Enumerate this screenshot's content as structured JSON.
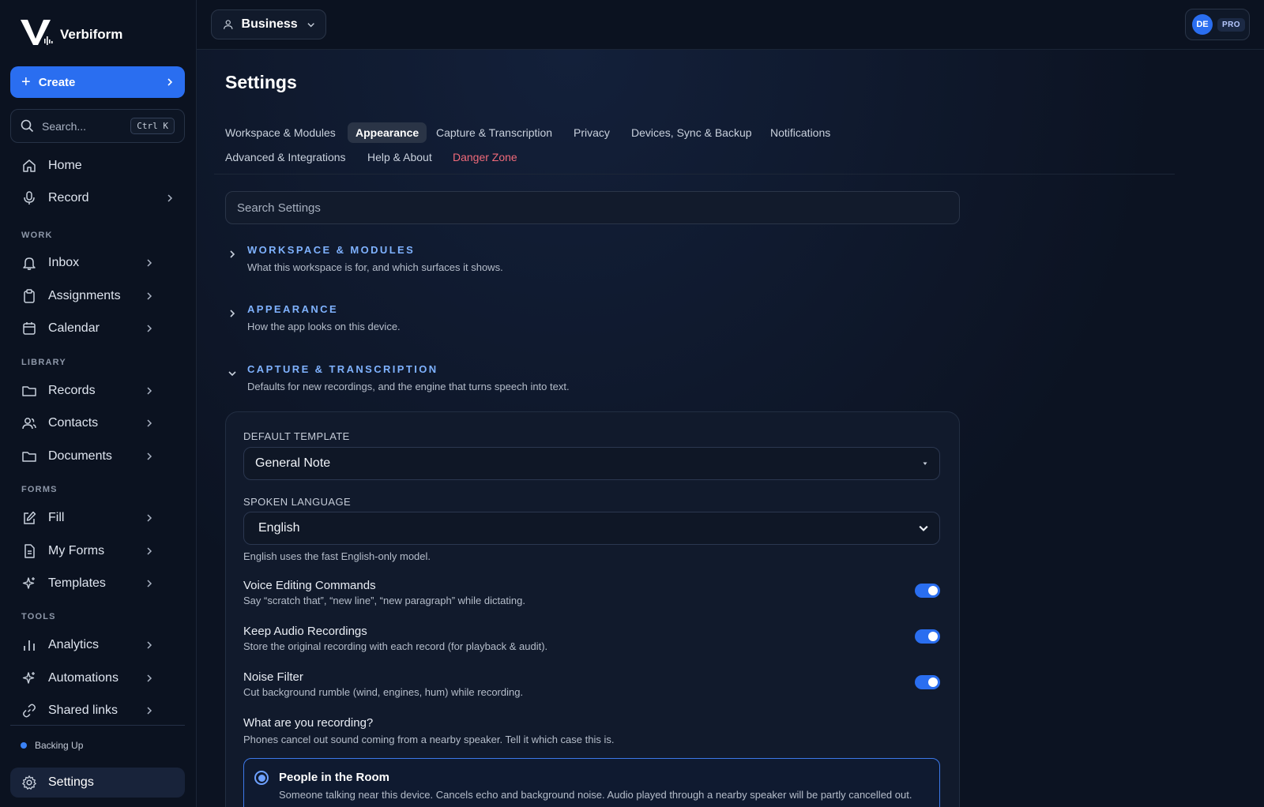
{
  "brand": {
    "name": "Verbiform"
  },
  "sidebar": {
    "create_label": "Create",
    "search_placeholder": "Search...",
    "search_shortcut": "Ctrl K",
    "top_items": [
      {
        "label": "Home",
        "icon": "home-icon"
      },
      {
        "label": "Record",
        "icon": "mic-icon"
      }
    ],
    "sections": [
      {
        "title": "WORK",
        "items": [
          {
            "label": "Inbox",
            "icon": "bell-icon"
          },
          {
            "label": "Assignments",
            "icon": "clipboard-icon"
          },
          {
            "label": "Calendar",
            "icon": "calendar-icon"
          }
        ]
      },
      {
        "title": "LIBRARY",
        "items": [
          {
            "label": "Records",
            "icon": "folder-icon"
          },
          {
            "label": "Contacts",
            "icon": "users-icon"
          },
          {
            "label": "Documents",
            "icon": "folder-icon"
          }
        ]
      },
      {
        "title": "FORMS",
        "items": [
          {
            "label": "Fill",
            "icon": "pencil-square-icon"
          },
          {
            "label": "My Forms",
            "icon": "document-icon"
          },
          {
            "label": "Templates",
            "icon": "sparkle-icon"
          }
        ]
      },
      {
        "title": "TOOLS",
        "items": [
          {
            "label": "Analytics",
            "icon": "bar-chart-icon"
          },
          {
            "label": "Automations",
            "icon": "sparkle-icon"
          },
          {
            "label": "Shared links",
            "icon": "link-icon"
          }
        ]
      }
    ],
    "status": "Backing Up",
    "settings_label": "Settings"
  },
  "topbar": {
    "workspace": "Business",
    "avatar_initials": "DE",
    "plan_badge": "PRO"
  },
  "settings": {
    "title": "Settings",
    "tabs": [
      "Workspace & Modules",
      "Appearance",
      "Capture & Transcription",
      "Privacy",
      "Devices, Sync & Backup",
      "Notifications",
      "Advanced & Integrations",
      "Help & About",
      "Danger Zone"
    ],
    "active_tab": "Appearance",
    "search_placeholder": "Search Settings",
    "sections": [
      {
        "title": "WORKSPACE & MODULES",
        "desc": "What this workspace is for, and which surfaces it shows.",
        "expanded": false
      },
      {
        "title": "APPEARANCE",
        "desc": "How the app looks on this device.",
        "expanded": false
      },
      {
        "title": "CAPTURE & TRANSCRIPTION",
        "desc": "Defaults for new recordings, and the engine that turns speech into text.",
        "expanded": true
      }
    ],
    "capture": {
      "default_template_label": "DEFAULT TEMPLATE",
      "default_template_value": "General Note",
      "spoken_language_label": "SPOKEN LANGUAGE",
      "spoken_language_value": "English",
      "language_hint": "English uses the fast English-only model.",
      "toggles": [
        {
          "title": "Voice Editing Commands",
          "desc": "Say “scratch that”, “new line”, “new paragraph” while dictating.",
          "on": true
        },
        {
          "title": "Keep Audio Recordings",
          "desc": "Store the original recording with each record (for playback & audit).",
          "on": true
        },
        {
          "title": "Noise Filter",
          "desc": "Cut background rumble (wind, engines, hum) while recording.",
          "on": true
        }
      ],
      "recording_question": "What are you recording?",
      "recording_hint": "Phones cancel out sound coming from a nearby speaker. Tell it which case this is.",
      "option": {
        "title": "People in the Room",
        "desc": "Someone talking near this device. Cancels echo and background noise. Audio played through a nearby speaker will be partly cancelled out."
      }
    }
  },
  "colors": {
    "accent": "#2a6ef0",
    "section_title": "#7fb2ff",
    "danger": "#f06a7a",
    "background": "#0c1322"
  }
}
